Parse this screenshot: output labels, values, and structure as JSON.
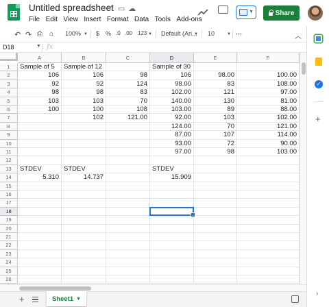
{
  "app": {
    "doc_title": "Untitled spreadsheet",
    "title_icons": [
      "star-icon",
      "folder-icon",
      "cloud-icon"
    ],
    "menu": [
      "File",
      "Edit",
      "View",
      "Insert",
      "Format",
      "Data",
      "Tools",
      "Add-ons"
    ],
    "share_label": "Share",
    "brand_color": "#0f9d58",
    "share_color": "#188038",
    "accent_color": "#1a73e8"
  },
  "toolbar": {
    "zoom": "100%",
    "currency": "$",
    "percent": "%",
    "dec_less": ".0",
    "dec_more": ".00",
    "format_more": "123",
    "font": "Default (Ari...",
    "font_size": "10",
    "more": "⋯"
  },
  "formula_bar": {
    "cell_ref": "D18",
    "fx": "fx"
  },
  "columns": [
    "A",
    "B",
    "C",
    "D",
    "E",
    "F"
  ],
  "rows": [
    "1",
    "2",
    "3",
    "4",
    "5",
    "6",
    "7",
    "8",
    "9",
    "10",
    "11",
    "12",
    "13",
    "14",
    "15",
    "16",
    "17",
    "18",
    "19",
    "20",
    "21",
    "22",
    "23",
    "24",
    "25",
    "26"
  ],
  "cells": {
    "r1": [
      "Sample of 5",
      "Sample of 12",
      "",
      "Sample of 30",
      "",
      ""
    ],
    "r2": [
      "106",
      "106",
      "98",
      "106",
      "98.00",
      "100.00"
    ],
    "r3": [
      "92",
      "92",
      "124",
      "98.00",
      "83",
      "108.00"
    ],
    "r4": [
      "98",
      "98",
      "83",
      "102.00",
      "121",
      "97.00"
    ],
    "r5": [
      "103",
      "103",
      "70",
      "140.00",
      "130",
      "81.00"
    ],
    "r6": [
      "100",
      "100",
      "108",
      "103.00",
      "89",
      "88.00"
    ],
    "r7": [
      "",
      "102",
      "121.00",
      "92.00",
      "103",
      "102.00"
    ],
    "r8": [
      "",
      "",
      "",
      "124.00",
      "70",
      "121.00"
    ],
    "r9": [
      "",
      "",
      "",
      "87.00",
      "107",
      "114.00"
    ],
    "r10": [
      "",
      "",
      "",
      "93.00",
      "72",
      "90.00"
    ],
    "r11": [
      "",
      "",
      "",
      "97.00",
      "98",
      "103.00"
    ],
    "r12": [
      "",
      "",
      "",
      "",
      "",
      ""
    ],
    "r13": [
      "STDEV",
      "STDEV",
      "",
      "STDEV",
      "",
      ""
    ],
    "r14": [
      "5.310",
      "14.737",
      "",
      "15.909",
      "",
      ""
    ]
  },
  "selected_cell": "D18",
  "sheet_tab": "Sheet1"
}
